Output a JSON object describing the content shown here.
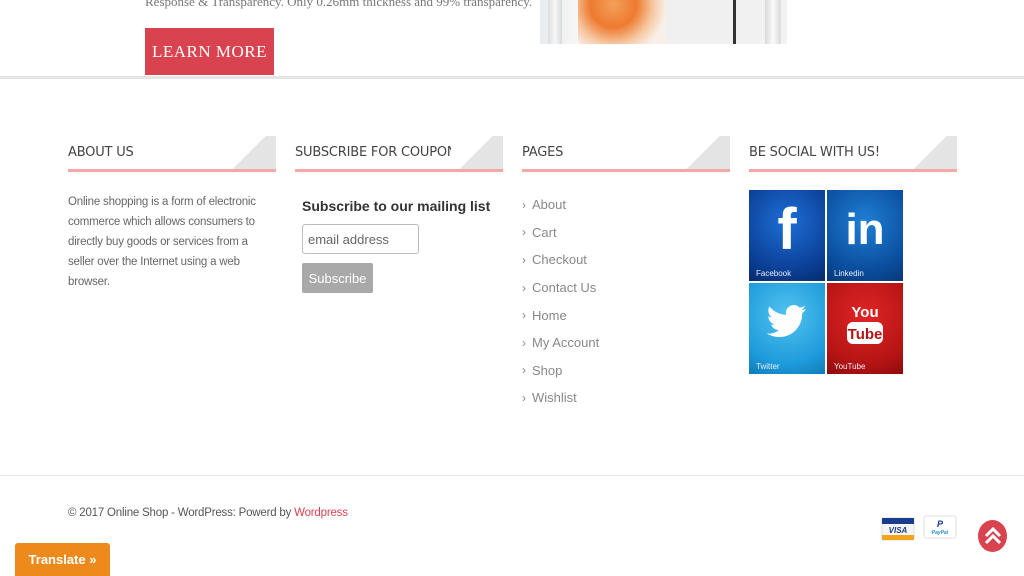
{
  "hero": {
    "text": "Response & Transparency. Only 0.26mm thickness and 99% transparency.",
    "learn_more": "LEARN MORE"
  },
  "about": {
    "title": "ABOUT US",
    "text": "Online shopping is a form of electronic commerce which allows consumers to directly buy goods or services from a seller over the Internet using a web browser."
  },
  "subscribe": {
    "title": "SUBSCRIBE FOR COUPONS!",
    "heading": "Subscribe to our mailing list",
    "placeholder": "email address",
    "button": "Subscribe"
  },
  "pages": {
    "title": "PAGES",
    "items": [
      "About",
      "Cart",
      "Checkout",
      "Contact Us",
      "Home",
      "My Account",
      "Shop",
      "Wishlist"
    ]
  },
  "social": {
    "title": "BE SOCIAL WITH US!",
    "tiles": [
      {
        "label": "Facebook",
        "glyph": "f",
        "icon": "facebook-icon",
        "color": "#0b3f95"
      },
      {
        "label": "Linkedin",
        "glyph": "in",
        "icon": "linkedin-icon",
        "color": "#0b4d9c"
      },
      {
        "label": "Twitter",
        "glyph": "",
        "icon": "twitter-icon",
        "color": "#1d9bdb"
      },
      {
        "label": "YouTube",
        "glyph": "You Tube",
        "icon": "youtube-icon",
        "color": "#b51414"
      }
    ]
  },
  "footer": {
    "copyright_prefix": "© 2017 Online Shop - WordPress: Powerd by ",
    "copyright_link": "Wordpress",
    "visa": "VISA",
    "paypal": "PayPal"
  },
  "translate": {
    "label": "Translate »"
  },
  "colors": {
    "accent": "#d9434f",
    "title_underline": "#f2a9a6",
    "translate_bg": "#ed8a1c"
  }
}
